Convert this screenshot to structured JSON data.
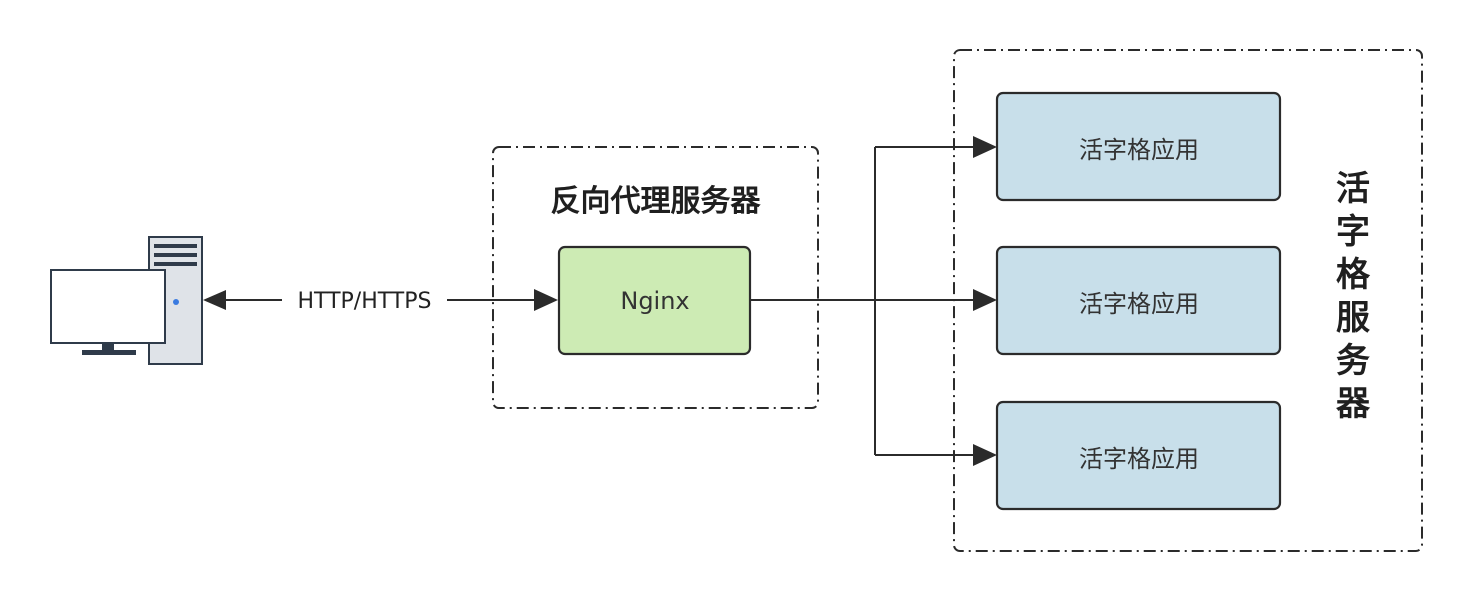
{
  "proxy_group": {
    "title": "反向代理服务器"
  },
  "nginx": {
    "label": "Nginx"
  },
  "client_edge": {
    "label": "HTTP/HTTPS"
  },
  "apps": [
    {
      "label": "活字格应用"
    },
    {
      "label": "活字格应用"
    },
    {
      "label": "活字格应用"
    }
  ],
  "server_group": {
    "title": "活字格服务器"
  },
  "colors": {
    "nginx_fill": "#cdebb4",
    "app_fill": "#c8dfea",
    "stroke": "#2b2b2b"
  },
  "icons": {
    "client": "computer-icon"
  }
}
